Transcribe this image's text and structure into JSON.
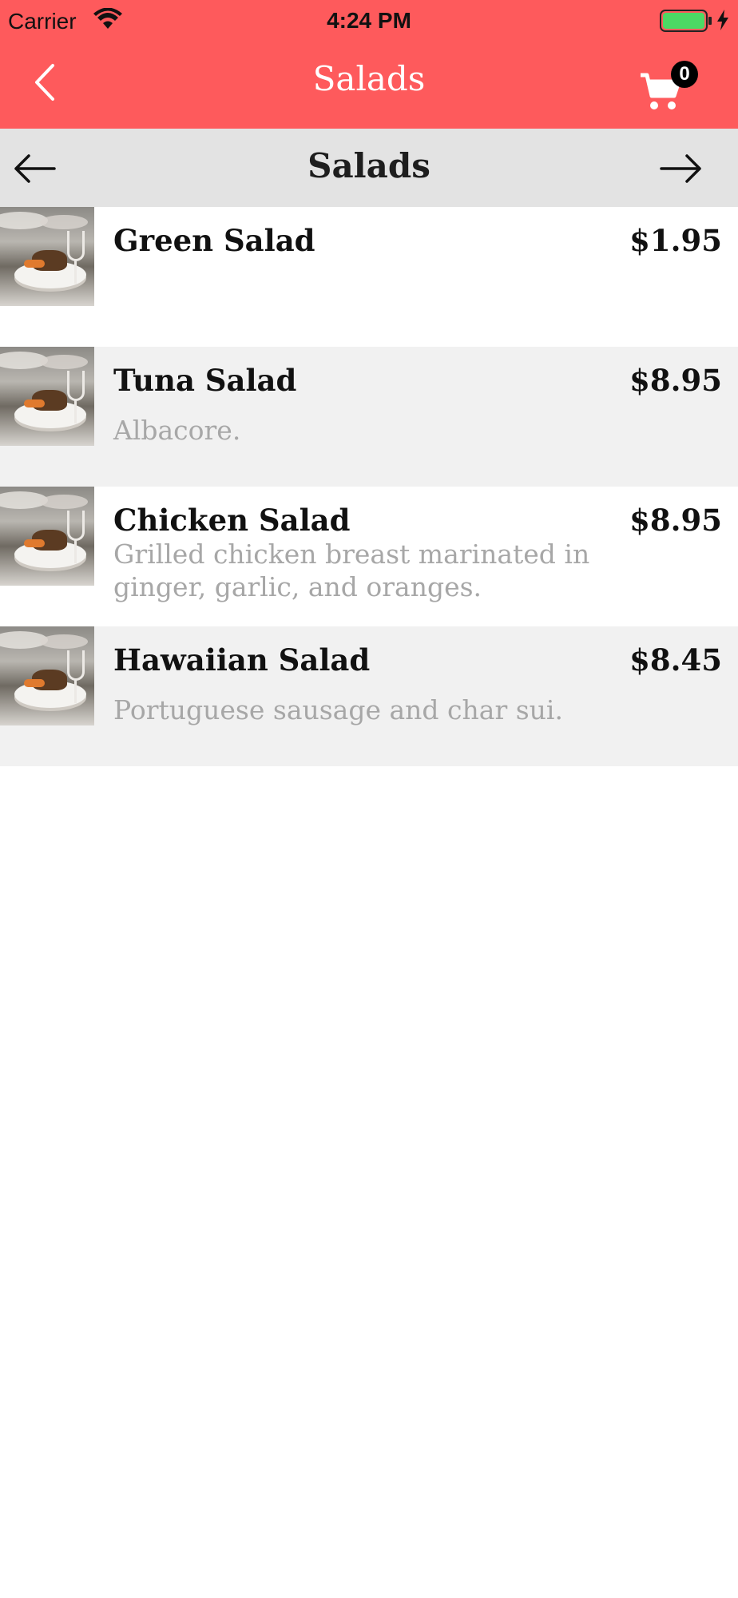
{
  "status_bar": {
    "carrier": "Carrier",
    "time": "4:24 PM",
    "battery_color": "#4cd964"
  },
  "nav": {
    "title": "Salads",
    "back_icon": "chevron-left-icon",
    "cart_icon": "cart-icon",
    "cart_count": "0"
  },
  "category": {
    "title": "Salads",
    "prev_icon": "arrow-left-icon",
    "next_icon": "arrow-right-icon"
  },
  "menu_items": [
    {
      "name": "Green Salad",
      "price": "$1.95",
      "description": ""
    },
    {
      "name": "Tuna Salad",
      "price": "$8.95",
      "description": "Albacore."
    },
    {
      "name": "Chicken Salad",
      "price": "$8.95",
      "description": "Grilled chicken breast marinated in ginger, garlic, and oranges."
    },
    {
      "name": "Hawaiian Salad",
      "price": "$8.45",
      "description": "Portuguese sausage and char sui."
    }
  ],
  "colors": {
    "brand_red": "#fe5a5c",
    "category_bar": "#e3e3e3",
    "alt_row": "#f1f1f1",
    "description_text": "#a7a7a7"
  }
}
